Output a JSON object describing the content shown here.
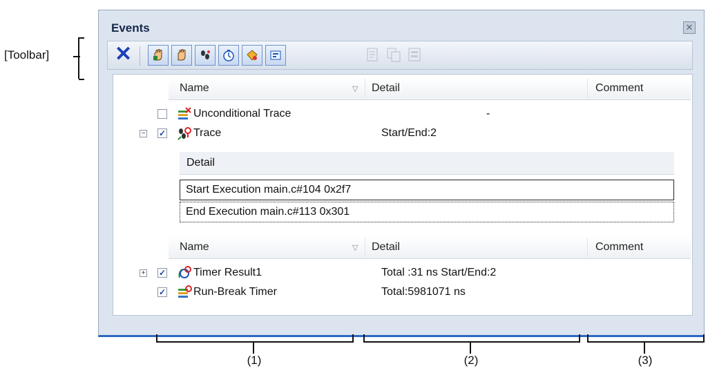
{
  "annotations": {
    "toolbar_label": "[Toolbar]",
    "col1_label": "(1)",
    "col2_label": "(2)",
    "col3_label": "(3)"
  },
  "window": {
    "title": "Events",
    "close_glyph": "✕"
  },
  "toolbar": {
    "delete_glyph": "✕",
    "buttons": [
      {
        "icon": "hardware-break-icon"
      },
      {
        "icon": "software-break-icon"
      },
      {
        "icon": "trace-icon"
      },
      {
        "icon": "timer-icon"
      },
      {
        "icon": "point-trace-icon"
      },
      {
        "icon": "predefined-event-icon"
      }
    ],
    "disabled_buttons": [
      {
        "icon": "edit-icon"
      },
      {
        "icon": "copy-icon"
      },
      {
        "icon": "list-icon"
      }
    ]
  },
  "columns": {
    "name": "Name",
    "detail": "Detail",
    "comment": "Comment"
  },
  "events_top": [
    {
      "name": "Unconditional Trace",
      "detail": "-",
      "checked": false,
      "expander": ""
    },
    {
      "name": "Trace",
      "detail": "Start/End:2",
      "checked": true,
      "expander": "−"
    }
  ],
  "trace_detail": {
    "header": "Detail",
    "rows": [
      "Start Execution main.c#104 0x2f7",
      "End Execution main.c#113 0x301"
    ]
  },
  "events_bottom": [
    {
      "name": "Timer Result1",
      "detail": "Total :31 ns  Start/End:2",
      "checked": true,
      "expander": "+"
    },
    {
      "name": "Run-Break Timer",
      "detail": "Total:5981071 ns",
      "checked": true,
      "expander": ""
    }
  ],
  "check_glyph": "✓",
  "colors": {
    "window_bg": "#dce4ef",
    "accent_blue": "#2c67c4",
    "delete_blue": "#1b3fb8"
  }
}
